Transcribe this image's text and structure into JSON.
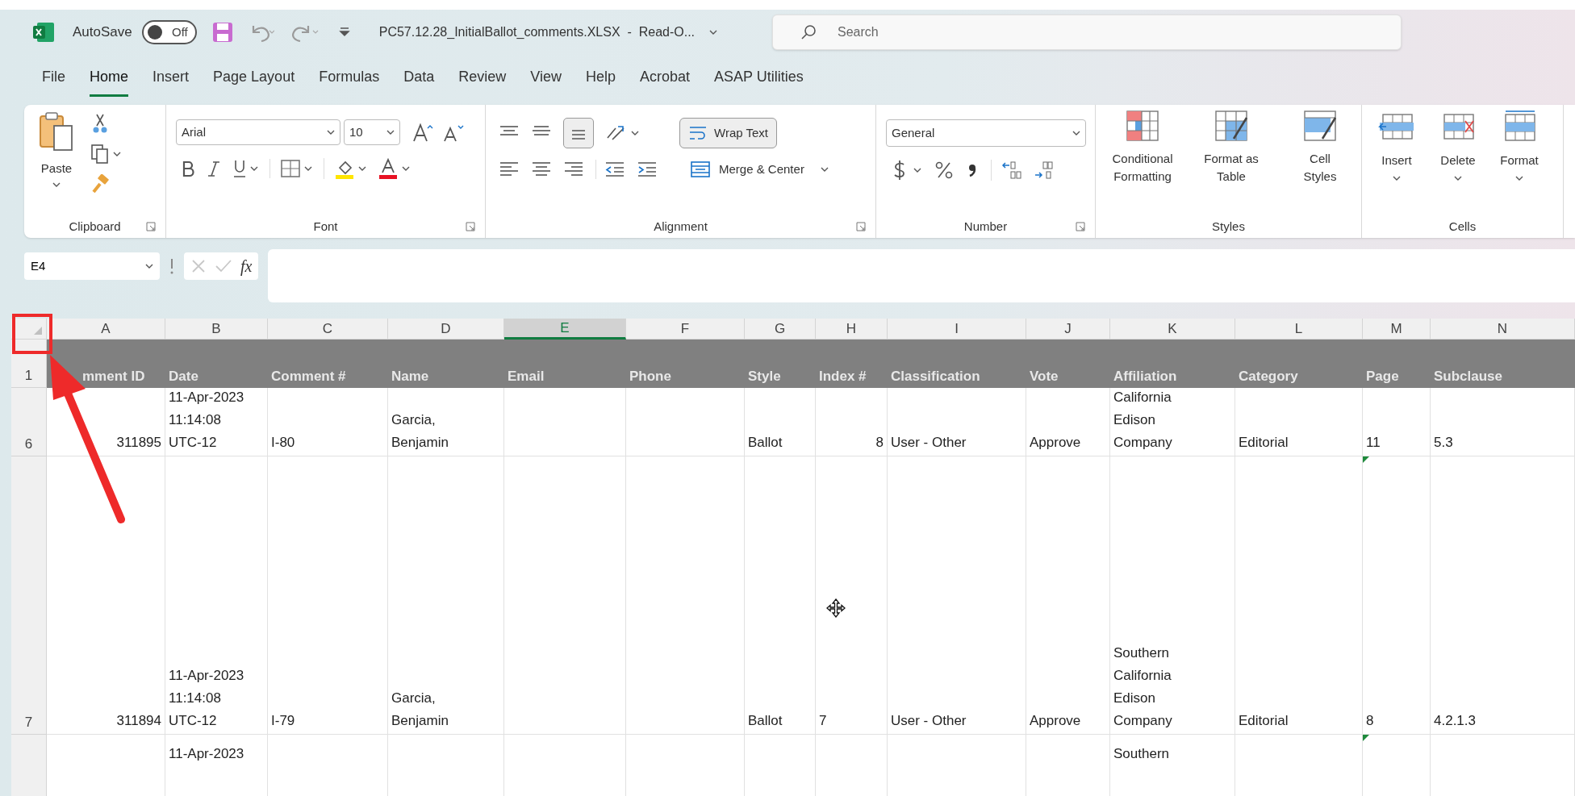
{
  "title_bar": {
    "autosave_label": "AutoSave",
    "autosave": {
      "on": false,
      "label": "Off"
    },
    "filename": "PC57.12.28_InitialBallot_comments.XLSX  -  Read-O...",
    "search": {
      "placeholder": "Search"
    }
  },
  "tabs": [
    {
      "label": "File",
      "selected": false
    },
    {
      "label": "Home",
      "selected": true
    },
    {
      "label": "Insert",
      "selected": false
    },
    {
      "label": "Page Layout",
      "selected": false
    },
    {
      "label": "Formulas",
      "selected": false
    },
    {
      "label": "Data",
      "selected": false
    },
    {
      "label": "Review",
      "selected": false
    },
    {
      "label": "View",
      "selected": false
    },
    {
      "label": "Help",
      "selected": false
    },
    {
      "label": "Acrobat",
      "selected": false
    },
    {
      "label": "ASAP Utilities",
      "selected": false
    }
  ],
  "ribbon": {
    "clipboard": {
      "paste": "Paste",
      "label": "Clipboard"
    },
    "font": {
      "name": "Arial",
      "size": "10",
      "label": "Font"
    },
    "alignment": {
      "wrap_text": "Wrap Text",
      "merge": "Merge & Center",
      "label": "Alignment"
    },
    "number": {
      "format": "General",
      "label": "Number"
    },
    "styles": {
      "buttons": [
        "Conditional\nFormatting",
        "Format as\nTable",
        "Cell\nStyles"
      ],
      "label": "Styles"
    },
    "cells": {
      "buttons": [
        "Insert",
        "Delete",
        "Format"
      ],
      "label": "Cells"
    }
  },
  "formula_bar": {
    "name_box": "E4",
    "fx": "fx"
  },
  "sheet": {
    "columns": [
      {
        "letter": "A",
        "selected": false
      },
      {
        "letter": "B",
        "selected": false
      },
      {
        "letter": "C",
        "selected": false
      },
      {
        "letter": "D",
        "selected": false
      },
      {
        "letter": "E",
        "selected": true
      },
      {
        "letter": "F",
        "selected": false
      },
      {
        "letter": "G",
        "selected": false
      },
      {
        "letter": "H",
        "selected": false
      },
      {
        "letter": "I",
        "selected": false
      },
      {
        "letter": "J",
        "selected": false
      },
      {
        "letter": "K",
        "selected": false
      },
      {
        "letter": "L",
        "selected": false
      },
      {
        "letter": "M",
        "selected": false
      },
      {
        "letter": "N",
        "selected": false
      }
    ],
    "header_row": {
      "row": "1",
      "cells": {
        "A": "mment ID",
        "B": "Date",
        "C": "Comment #",
        "D": "Name",
        "E": "Email",
        "F": "Phone",
        "G": "Style",
        "H": "Index #",
        "I": "Classification",
        "J": "Vote",
        "K": "Affiliation",
        "L": "Category",
        "M": "Page",
        "N": "Subclause"
      }
    },
    "rows": [
      {
        "row": "6",
        "cells": {
          "A": {
            "text": "311895",
            "kind": "number"
          },
          "B": {
            "text": "11-Apr-2023\n11:14:08\nUTC-12",
            "kind": "text"
          },
          "C": {
            "text": "I-80",
            "kind": "text"
          },
          "D": {
            "text": "Garcia,\nBenjamin",
            "kind": "text"
          },
          "G": {
            "text": "Ballot",
            "kind": "text"
          },
          "H": {
            "text": "8",
            "kind": "number"
          },
          "I": {
            "text": "User - Other",
            "kind": "text"
          },
          "J": {
            "text": "Approve",
            "kind": "text"
          },
          "K": {
            "text": "California\nEdison\nCompany",
            "kind": "text"
          },
          "L": {
            "text": "Editorial",
            "kind": "text"
          },
          "M": {
            "text": "11",
            "kind": "text"
          },
          "N": {
            "text": "5.3",
            "kind": "text"
          }
        }
      },
      {
        "row": "7",
        "cells": {
          "A": {
            "text": "311894",
            "kind": "number"
          },
          "B": {
            "text": "11-Apr-2023\n11:14:08\nUTC-12",
            "kind": "text"
          },
          "C": {
            "text": "I-79",
            "kind": "text"
          },
          "D": {
            "text": "Garcia,\nBenjamin",
            "kind": "text"
          },
          "G": {
            "text": "Ballot",
            "kind": "text"
          },
          "H": {
            "text": "7",
            "kind": "text"
          },
          "I": {
            "text": "User - Other",
            "kind": "text"
          },
          "J": {
            "text": "Approve",
            "kind": "text"
          },
          "K": {
            "text": "Southern\nCalifornia\nEdison\nCompany",
            "kind": "text"
          },
          "L": {
            "text": "Editorial",
            "kind": "text"
          },
          "M": {
            "text": "8",
            "kind": "text",
            "flag": true
          },
          "N": {
            "text": "4.2.1.3",
            "kind": "text"
          }
        }
      },
      {
        "row": "",
        "partial": true,
        "cells": {
          "B": {
            "text": "11-Apr-2023",
            "kind": "text"
          },
          "K": {
            "text": "Southern",
            "kind": "text"
          },
          "M": {
            "flag": true,
            "kind": "empty"
          }
        }
      }
    ]
  }
}
